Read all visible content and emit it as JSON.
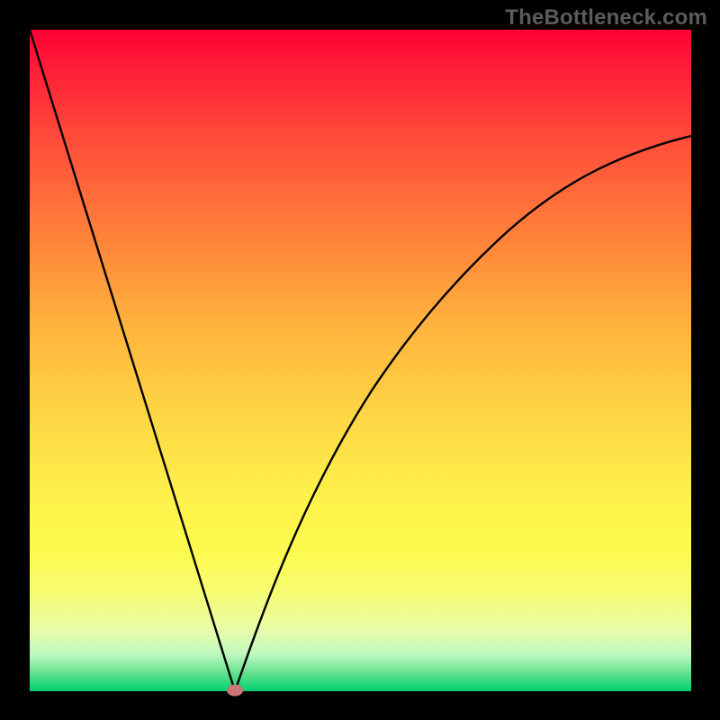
{
  "watermark": "TheBottleneck.com",
  "chart_data": {
    "type": "line",
    "title": "",
    "xlabel": "",
    "ylabel": "",
    "xlim": [
      0,
      100
    ],
    "ylim": [
      0,
      100
    ],
    "grid": false,
    "legend": false,
    "background": "rainbow-gradient-red-to-green",
    "marker": {
      "x": 31,
      "y": 0,
      "color": "#c87774",
      "shape": "ellipse"
    },
    "series": [
      {
        "name": "left-branch",
        "x": [
          0,
          5,
          10,
          15,
          20,
          25,
          29,
          31
        ],
        "values": [
          100,
          84,
          68,
          52,
          36,
          19,
          5,
          0
        ]
      },
      {
        "name": "right-branch",
        "x": [
          31,
          33,
          36,
          40,
          45,
          50,
          56,
          62,
          70,
          78,
          86,
          93,
          100
        ],
        "values": [
          0,
          7,
          18,
          30,
          42,
          51,
          59,
          65,
          71,
          76,
          79,
          82,
          84
        ]
      }
    ]
  }
}
